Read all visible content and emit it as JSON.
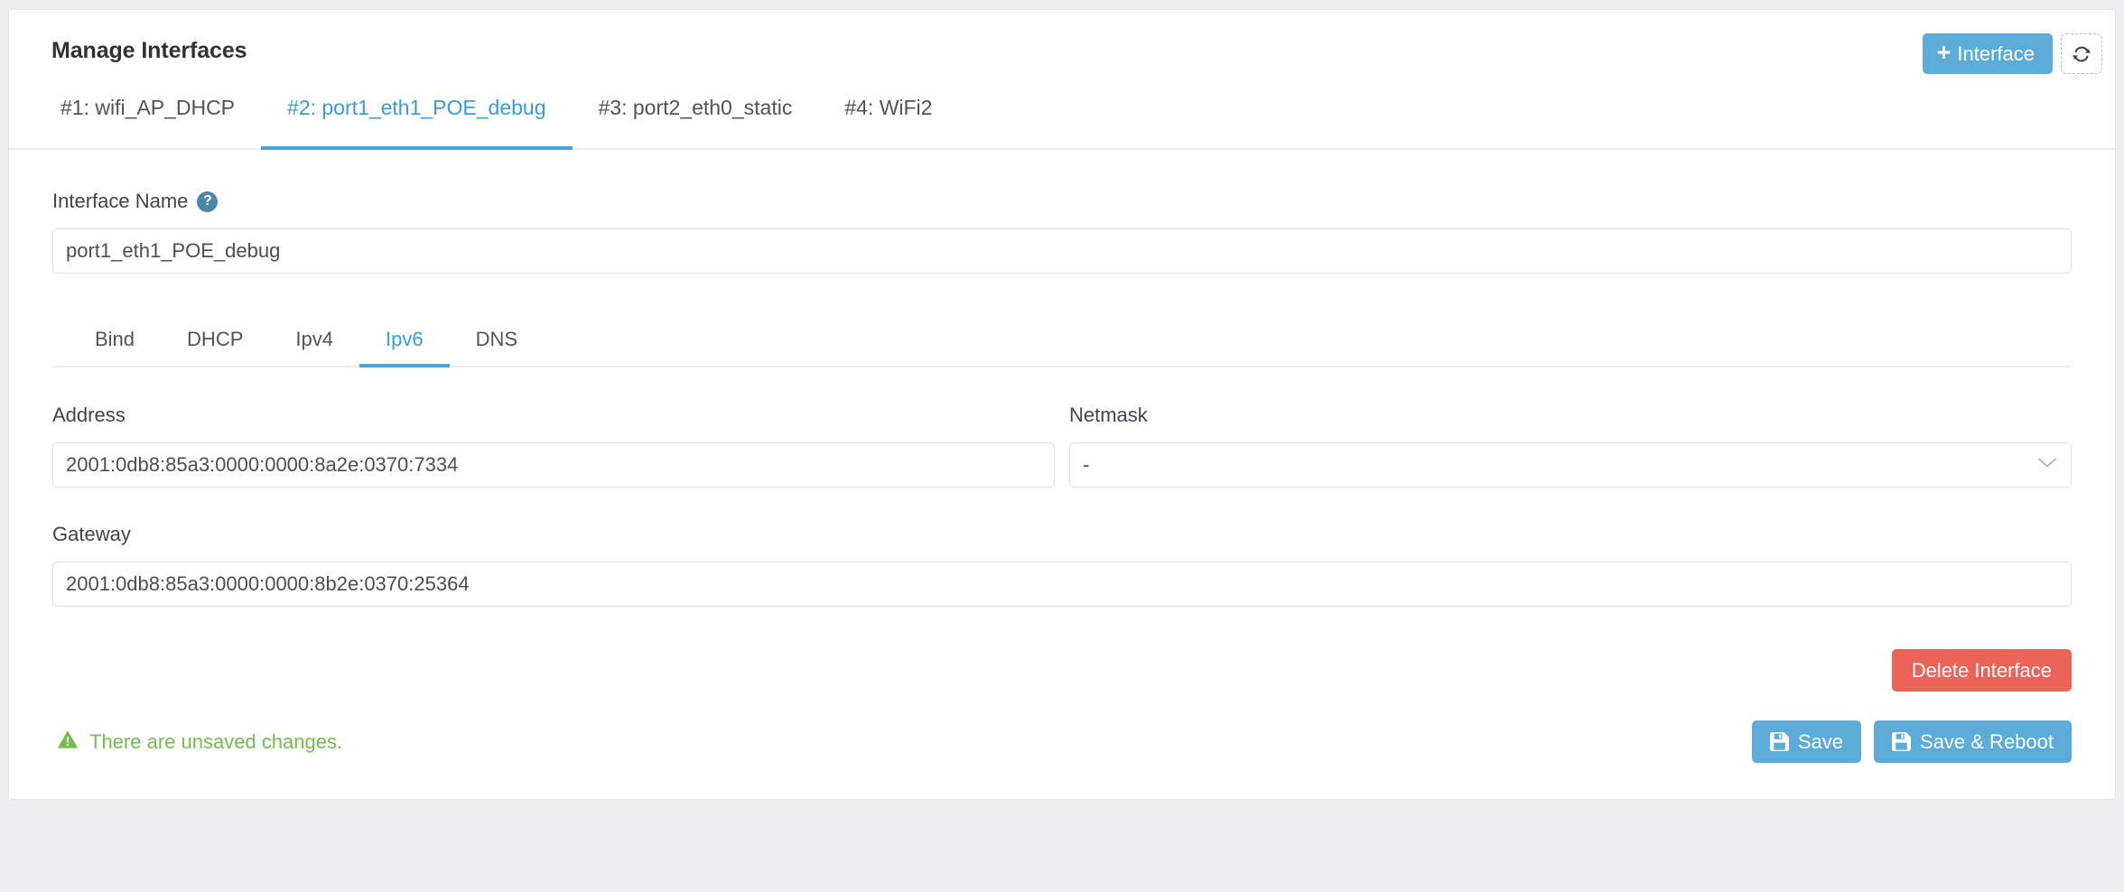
{
  "header": {
    "title": "Manage Interfaces",
    "add_interface_label": "Interface",
    "add_icon": "plus-icon",
    "refresh_icon": "refresh-icon"
  },
  "interface_tabs": [
    {
      "label": "#1: wifi_AP_DHCP",
      "active": false
    },
    {
      "label": "#2: port1_eth1_POE_debug",
      "active": true
    },
    {
      "label": "#3: port2_eth0_static",
      "active": false
    },
    {
      "label": "#4: WiFi2",
      "active": false
    }
  ],
  "interface_name": {
    "label": "Interface Name",
    "help_icon": "help-circle-icon",
    "value": "port1_eth1_POE_debug",
    "placeholder": "Interface Name"
  },
  "config_tabs": [
    {
      "label": "Bind",
      "active": false
    },
    {
      "label": "DHCP",
      "active": false
    },
    {
      "label": "Ipv4",
      "active": false
    },
    {
      "label": "Ipv6",
      "active": true
    },
    {
      "label": "DNS",
      "active": false
    }
  ],
  "ipv6": {
    "address": {
      "label": "Address",
      "value": "2001:0db8:85a3:0000:0000:8a2e:0370:7334",
      "placeholder": "Address"
    },
    "netmask": {
      "label": "Netmask",
      "value": "-",
      "chevron_icon": "chevron-down-icon"
    },
    "gateway": {
      "label": "Gateway",
      "value": "2001:0db8:85a3:0000:0000:8b2e:0370:25364",
      "placeholder": "Gateway"
    }
  },
  "actions": {
    "delete_label": "Delete Interface",
    "save_label": "Save",
    "save_reboot_label": "Save & Reboot",
    "save_icon": "floppy-disk-icon"
  },
  "status": {
    "unsaved_text": "There are unsaved changes.",
    "warning_icon": "warning-triangle-icon"
  },
  "colors": {
    "accent_blue": "#5bacd8",
    "tab_active_blue": "#3b9cd9",
    "danger_red": "#ec6459",
    "success_green": "#70bf4b",
    "help_icon_blue": "#4a88a8",
    "page_bg": "#eceef0"
  }
}
